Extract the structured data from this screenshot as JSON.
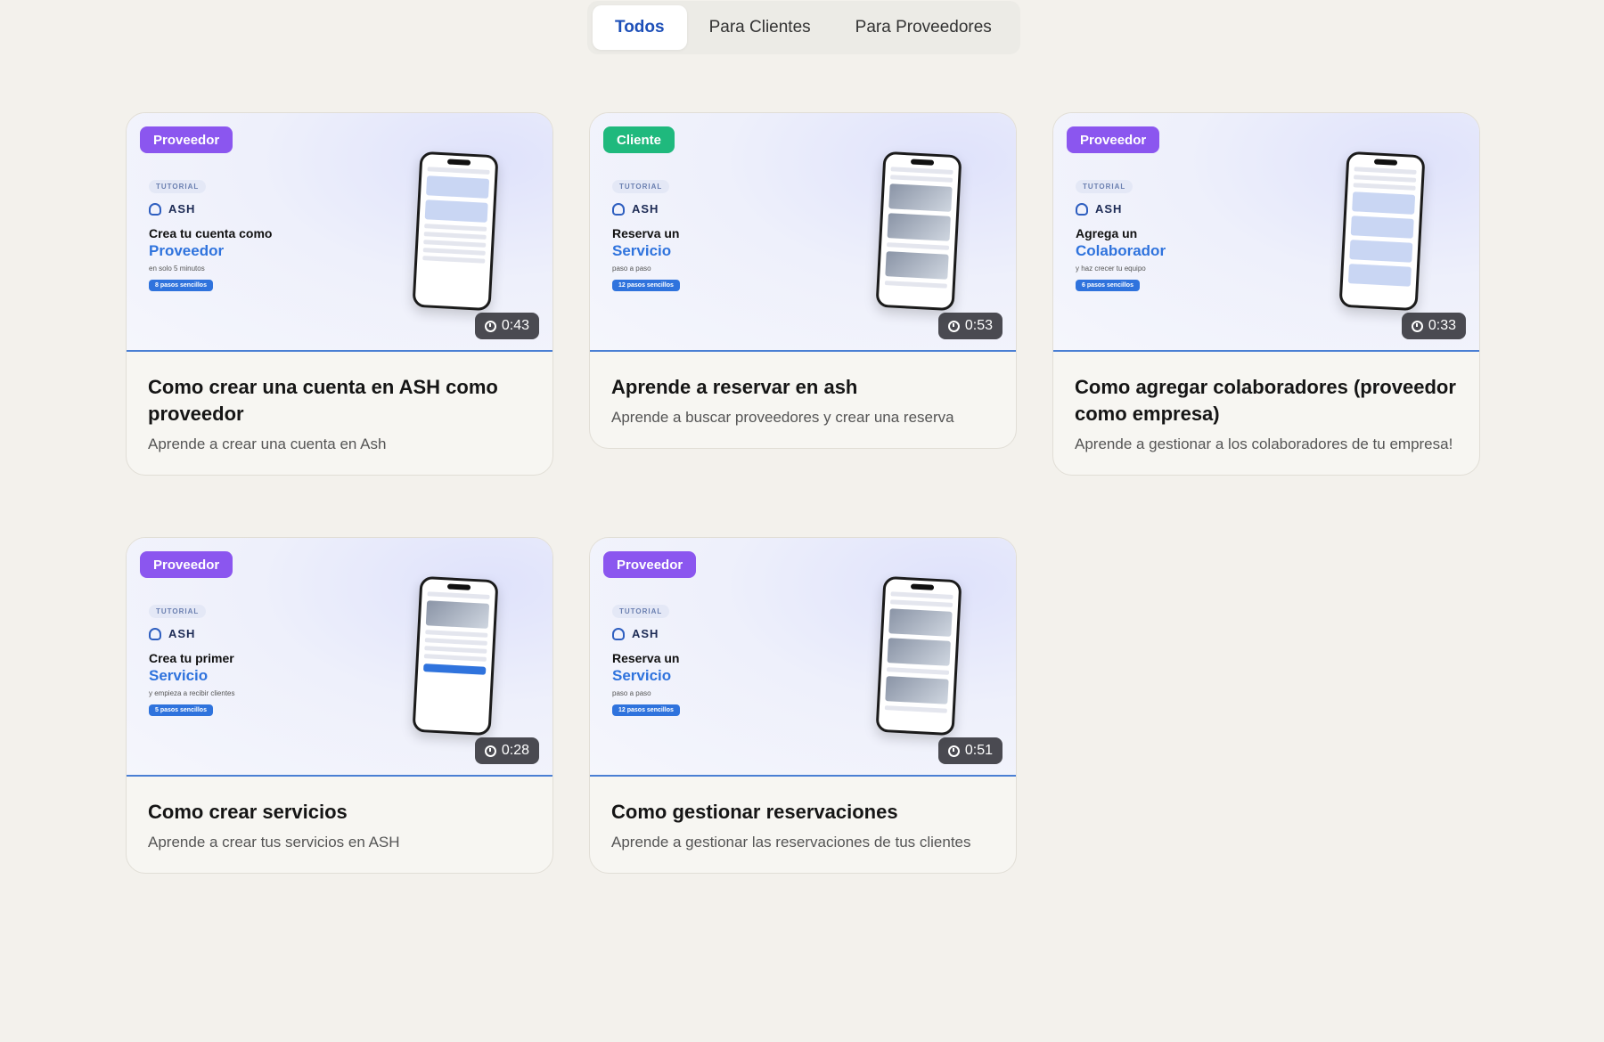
{
  "tabs": [
    {
      "label": "Todos",
      "active": true
    },
    {
      "label": "Para Clientes",
      "active": false
    },
    {
      "label": "Para Proveedores",
      "active": false
    }
  ],
  "cards": [
    {
      "badge": "Proveedor",
      "badge_type": "proveedor",
      "slide": {
        "tag": "TUTORIAL",
        "brand": "ASH",
        "line1": "Crea tu cuenta como",
        "line2": "Proveedor",
        "line3": "en solo 5 minutos",
        "pill": "8 pasos sencillos"
      },
      "duration": "0:43",
      "title": "Como crear una cuenta en ASH como proveedor",
      "description": "Aprende a crear una cuenta en Ash"
    },
    {
      "badge": "Cliente",
      "badge_type": "cliente",
      "slide": {
        "tag": "TUTORIAL",
        "brand": "ASH",
        "line1": "Reserva un",
        "line2": "Servicio",
        "line3": "paso a paso",
        "pill": "12 pasos sencillos"
      },
      "duration": "0:53",
      "title": "Aprende a reservar en ash",
      "description": "Aprende a buscar proveedores y crear una reserva"
    },
    {
      "badge": "Proveedor",
      "badge_type": "proveedor",
      "slide": {
        "tag": "TUTORIAL",
        "brand": "ASH",
        "line1": "Agrega un",
        "line2": "Colaborador",
        "line3": "y haz crecer tu equipo",
        "pill": "6 pasos sencillos"
      },
      "duration": "0:33",
      "title": "Como agregar colaboradores (proveedor como empresa)",
      "description": "Aprende a gestionar a los colaboradores de tu empresa!"
    },
    {
      "badge": "Proveedor",
      "badge_type": "proveedor",
      "slide": {
        "tag": "TUTORIAL",
        "brand": "ASH",
        "line1": "Crea tu primer",
        "line2": "Servicio",
        "line3": "y empieza a recibir clientes",
        "pill": "5 pasos sencillos"
      },
      "duration": "0:28",
      "title": "Como crear servicios",
      "description": "Aprende a crear tus servicios en ASH"
    },
    {
      "badge": "Proveedor",
      "badge_type": "proveedor",
      "slide": {
        "tag": "TUTORIAL",
        "brand": "ASH",
        "line1": "Reserva un",
        "line2": "Servicio",
        "line3": "paso a paso",
        "pill": "12 pasos sencillos"
      },
      "duration": "0:51",
      "title": "Como gestionar reservaciones",
      "description": "Aprende a gestionar las reservaciones de tus clientes"
    }
  ]
}
